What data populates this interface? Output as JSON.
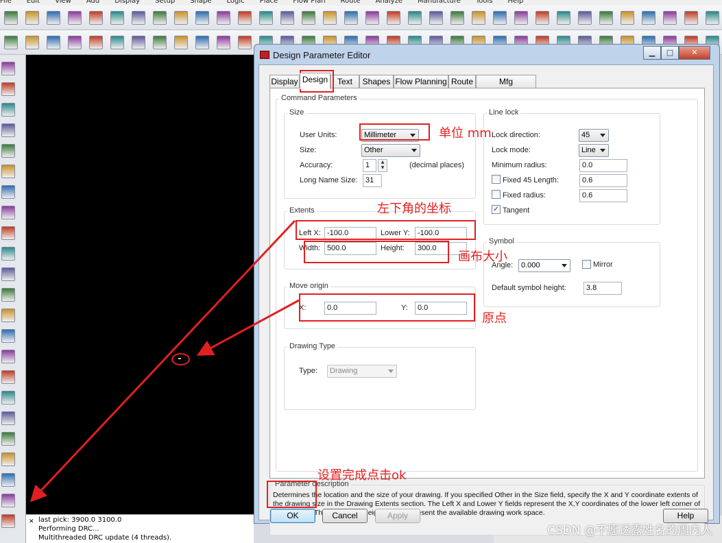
{
  "app_menu": [
    "File",
    "Edit",
    "View",
    "Add",
    "Display",
    "Setup",
    "Shape",
    "Logic",
    "Place",
    "Flow Plan",
    "Route",
    "Analyze",
    "Manufacture",
    "Tools",
    "Help"
  ],
  "status_lines": [
    "last pick:  3900.0  3100.0",
    "Performing DRC...",
    "Multithreaded DRC update (4 threads)."
  ],
  "dialog": {
    "title": "Design Parameter Editor",
    "tabs": [
      "Display",
      "Design",
      "Text",
      "Shapes",
      "Flow Planning",
      "Route",
      "Mfg Applications"
    ],
    "active_tab": "Design",
    "command_parameters_label": "Command Parameters",
    "size_group": {
      "label": "Size",
      "user_units_label": "User Units:",
      "user_units_value": "Millimeter",
      "size_label": "Size:",
      "size_value": "Other",
      "accuracy_label": "Accuracy:",
      "accuracy_value": "1",
      "accuracy_suffix": "(decimal places)",
      "long_name_label": "Long Name Size:",
      "long_name_value": "31"
    },
    "extents_group": {
      "label": "Extents",
      "left_x_label": "Left X:",
      "left_x_value": "-100.0",
      "lower_y_label": "Lower Y:",
      "lower_y_value": "-100.0",
      "width_label": "Width:",
      "width_value": "500.0",
      "height_label": "Height:",
      "height_value": "300.0"
    },
    "move_origin_group": {
      "label": "Move origin",
      "x_label": "X:",
      "x_value": "0.0",
      "y_label": "Y:",
      "y_value": "0.0"
    },
    "drawing_type_group": {
      "label": "Drawing Type",
      "type_label": "Type:",
      "type_value": "Drawing"
    },
    "line_lock_group": {
      "label": "Line lock",
      "lock_direction_label": "Lock direction:",
      "lock_direction_value": "45",
      "lock_mode_label": "Lock mode:",
      "lock_mode_value": "Line",
      "min_radius_label": "Minimum radius:",
      "min_radius_value": "0.0",
      "fixed45_label": "Fixed 45 Length:",
      "fixed45_value": "0.6",
      "fixed45_checked": false,
      "fixed_radius_label": "Fixed radius:",
      "fixed_radius_value": "0.6",
      "fixed_radius_checked": false,
      "tangent_label": "Tangent",
      "tangent_checked": true
    },
    "symbol_group": {
      "label": "Symbol",
      "angle_label": "Angle:",
      "angle_value": "0.000",
      "mirror_label": "Mirror",
      "mirror_checked": false,
      "default_height_label": "Default symbol height:",
      "default_height_value": "3.8"
    },
    "description_group": {
      "label": "Parameter description",
      "text": "Determines the location and the size of your drawing.  If you specified Other in the Size field, specify the X and Y coordinate extents of the drawing size in the Drawing Extents section. The Left X and Lower Y fields represent the X,Y coordinates of the lower left corner of the drawing.  The Width and Height fields represent the available drawing work space."
    },
    "buttons": {
      "ok": "OK",
      "cancel": "Cancel",
      "apply": "Apply",
      "help": "Help"
    }
  },
  "annotations": {
    "unit_note": "单位 mm",
    "corner_note": "左下角的坐标",
    "canvas_size_note": "画布大小",
    "origin_note": "原点",
    "finish_note": "设置完成点击ok",
    "annotation_color": "#e52020"
  },
  "watermark": "CSDN @不愿透露姓名的周内人"
}
